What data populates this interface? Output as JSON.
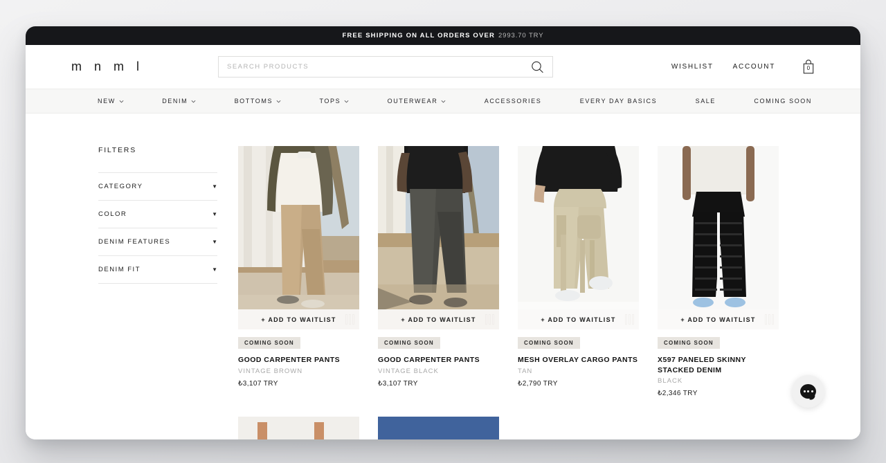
{
  "announcement": {
    "text": "FREE SHIPPING ON ALL ORDERS OVER",
    "amount": "2993.70 TRY"
  },
  "header": {
    "logo": "m n m l",
    "search": {
      "placeholder": "SEARCH PRODUCTS",
      "value": "",
      "icon": "search-icon"
    },
    "wishlist_label": "WISHLIST",
    "account_label": "ACCOUNT",
    "cart": {
      "icon": "shopping-bag-icon",
      "count": "0"
    }
  },
  "nav": {
    "items": [
      {
        "label": "NEW",
        "has_dropdown": true
      },
      {
        "label": "DENIM",
        "has_dropdown": true
      },
      {
        "label": "BOTTOMS",
        "has_dropdown": true
      },
      {
        "label": "TOPS",
        "has_dropdown": true
      },
      {
        "label": "OUTERWEAR",
        "has_dropdown": true
      },
      {
        "label": "ACCESSORIES",
        "has_dropdown": false
      },
      {
        "label": "EVERY DAY BASICS",
        "has_dropdown": false
      },
      {
        "label": "SALE",
        "has_dropdown": false
      },
      {
        "label": "COMING SOON",
        "has_dropdown": false
      }
    ]
  },
  "filters": {
    "title": "FILTERS",
    "caret": "▼",
    "groups": [
      {
        "label": "CATEGORY"
      },
      {
        "label": "COLOR"
      },
      {
        "label": "DENIM FEATURES"
      },
      {
        "label": "DENIM FIT"
      }
    ]
  },
  "products": [
    {
      "title": "GOOD CARPENTER PANTS",
      "color": "VINTAGE BROWN",
      "price": "₺3,107 TRY",
      "badge": "COMING SOON",
      "waitlist_label": "+ ADD TO WAITLIST"
    },
    {
      "title": "GOOD CARPENTER PANTS",
      "color": "VINTAGE BLACK",
      "price": "₺3,107 TRY",
      "badge": "COMING SOON",
      "waitlist_label": "+ ADD TO WAITLIST"
    },
    {
      "title": "MESH OVERLAY CARGO PANTS",
      "color": "TAN",
      "price": "₺2,790 TRY",
      "badge": "COMING SOON",
      "waitlist_label": "+ ADD TO WAITLIST"
    },
    {
      "title": "X597 PANELED SKINNY STACKED DENIM",
      "color": "BLACK",
      "price": "₺2,346 TRY",
      "badge": "COMING SOON",
      "waitlist_label": "+ ADD TO WAITLIST"
    }
  ],
  "chat": {
    "icon": "chat-bubble-icon"
  },
  "colors": {
    "announcement_bg": "#16171a",
    "nav_bg": "#f7f7f6",
    "badge_bg": "#e7e4df",
    "text": "#1b1b1b",
    "muted": "#a9a9a9"
  }
}
